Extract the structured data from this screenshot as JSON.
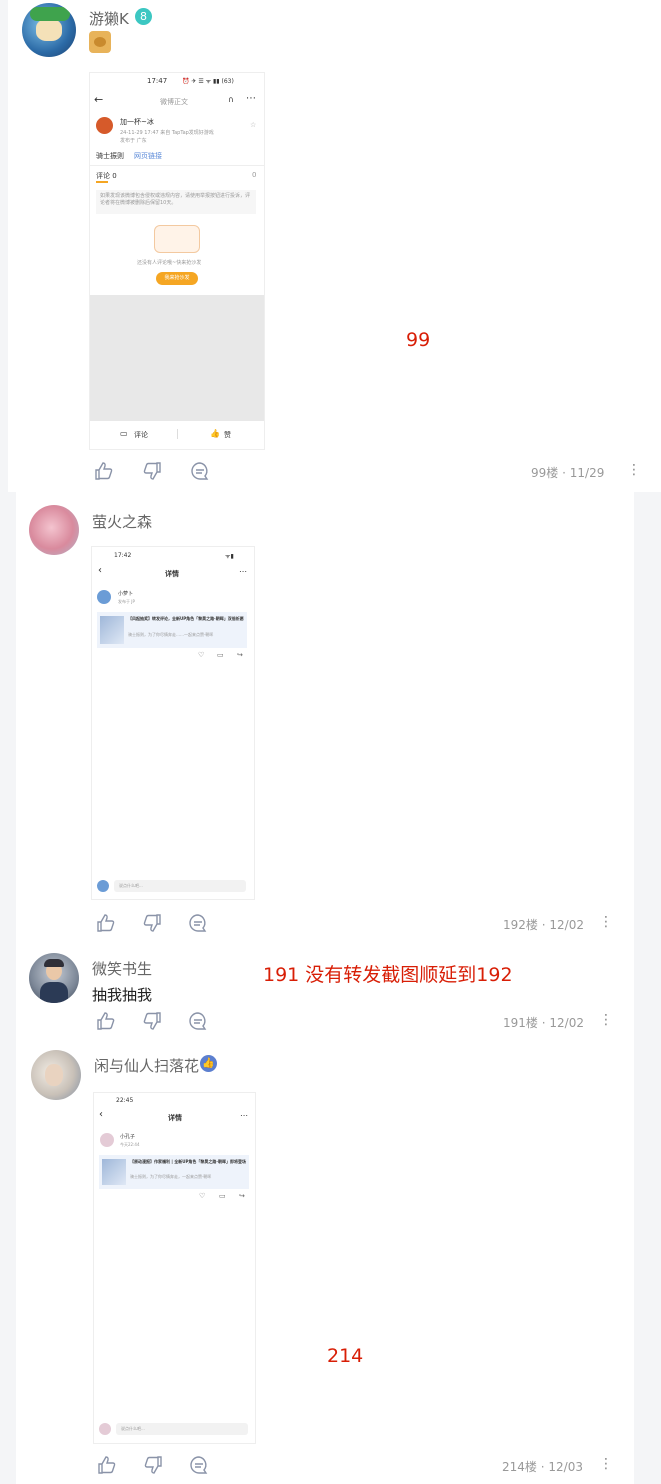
{
  "posts": [
    {
      "username": "游獭K",
      "badge": "8",
      "floor_label": "99楼",
      "date": "11/29",
      "annotation": "99",
      "more": "⋮",
      "screenshot": {
        "time": "17:47",
        "status_icons": "⏰ ✈ ☰ ᯤ ▮▮ (63)",
        "title": "微博正文",
        "poster": "加一杯~冰",
        "post_meta": "24-11-29 17:47 来自 TapTap发现好游戏",
        "location": "发布于 广东",
        "body": "骑士振则",
        "link": "网页链接",
        "comments_tab": "评论 0",
        "likes_tab": "0",
        "notice": "如果发现该微博包含侵权或违规内容，请使用举报按钮进行投诉，评论者将在微博被删除后保留10天。",
        "empty_text": "还没有人评论哦~快来抢沙发",
        "cta": "我来抢沙发",
        "bottom_comment": "评论",
        "bottom_like": "赞"
      }
    },
    {
      "username": "萤火之森",
      "floor_label": "192楼",
      "date": "12/02",
      "more": "⋮",
      "screenshot": {
        "time": "17:42",
        "title": "详情",
        "poster": "小萝卜",
        "post_meta": "发布于 JP",
        "card_title": "【风起抽奖】转发评论，全新UP角色「黎昊之路·朝晖」双倍祈愿",
        "card_sub": "骑士振则，为了你尽情奔走……一起来点赞·朝晖",
        "input_placeholder": "说点什么吧..."
      }
    },
    {
      "username": "微笑书生",
      "content": "抽我抽我",
      "floor_label": "191楼",
      "date": "12/02",
      "annotation": "191 没有转发截图顺延到192",
      "more": "⋮"
    },
    {
      "username": "闲与仙人扫落花",
      "floor_label": "214楼",
      "date": "12/03",
      "annotation": "214",
      "more": "⋮",
      "screenshot": {
        "time": "22:45",
        "title": "详情",
        "poster": "小孔子",
        "post_meta": "今天22:44",
        "card_title": "【原动漫报】作家福利 | 全新UP角色「黎昊之路·朝晖」即将登场",
        "card_sub": "骑士振则，为了你尽情奔走，一起来点赞·朝晖",
        "input_placeholder": "说点什么吧..."
      }
    }
  ],
  "meta_separator": "·",
  "colors": {
    "annotation": "#d81e06",
    "accent": "#f5a623",
    "link": "#5b8ad8"
  }
}
